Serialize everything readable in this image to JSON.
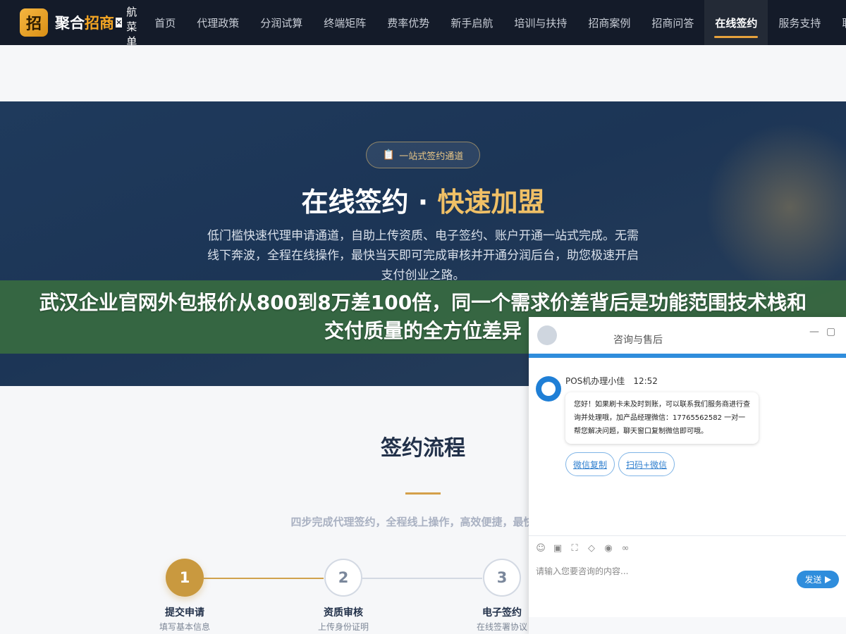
{
  "nav": {
    "logo_char": "招",
    "brand_main": "聚合",
    "brand_accent": "招商",
    "close_glyph": "×",
    "menu_label": [
      "航",
      "菜",
      "单"
    ],
    "items": [
      {
        "label": "首页"
      },
      {
        "label": "代理政策"
      },
      {
        "label": "分润试算"
      },
      {
        "label": "终端矩阵"
      },
      {
        "label": "费率优势"
      },
      {
        "label": "新手启航"
      },
      {
        "label": "培训与扶持"
      },
      {
        "label": "招商案例"
      },
      {
        "label": "招商问答"
      },
      {
        "label": "在线签约",
        "active": true
      },
      {
        "label": "服务支持"
      },
      {
        "label": "联系"
      }
    ],
    "accent_color": "#e6a23c"
  },
  "hero": {
    "badge_icon": "clipboard-icon",
    "badge": "一站式签约通道",
    "title_white": "在线签约 · ",
    "title_gold": "快速加盟",
    "desc": "低门槛快速代理申请通道，自助上传资质、电子签约、账户开通一站式完成。无需线下奔波，全程在线操作，最快当天即可完成审核并开通分润后台，助您极速开启支付创业之路。"
  },
  "headline": "武汉企业官网外包报价从800到8万差100倍，同一个需求价差背后是功能范围技术栈和交付质量的全方位差异",
  "process": {
    "title": "签约流程",
    "subtitle": "四步完成代理签约，全程线上操作，高效便捷，最快当天",
    "steps": [
      {
        "num": "1",
        "name": "提交申请",
        "desc": "填写基本信息",
        "active": true
      },
      {
        "num": "2",
        "name": "资质审核",
        "desc": "上传身份证明",
        "active": false
      },
      {
        "num": "3",
        "name": "电子签约",
        "desc": "在线签署协议",
        "active": false
      }
    ]
  },
  "chat": {
    "title": "咨询与售后",
    "minimize": "—",
    "maximize": "▢",
    "agent_name": "POS机办理小佳",
    "time": "12:52",
    "message": "您好！如果刷卡未及时到账，可以联系我们服务商进行查询并处理哦，加产品经理微信：17765562582 一对一帮您解决问题，聊天窗口复制微信即可哦。",
    "quick_buttons": [
      "微信复制",
      "扫码+微信"
    ],
    "tools": [
      "emoji-icon",
      "image-icon",
      "screenshot-icon",
      "shield-icon",
      "eye-icon",
      "wechat-icon"
    ],
    "input_placeholder": "请输入您要咨询的内容...",
    "send_label": "发送",
    "brand_color": "#2f8ddc"
  }
}
